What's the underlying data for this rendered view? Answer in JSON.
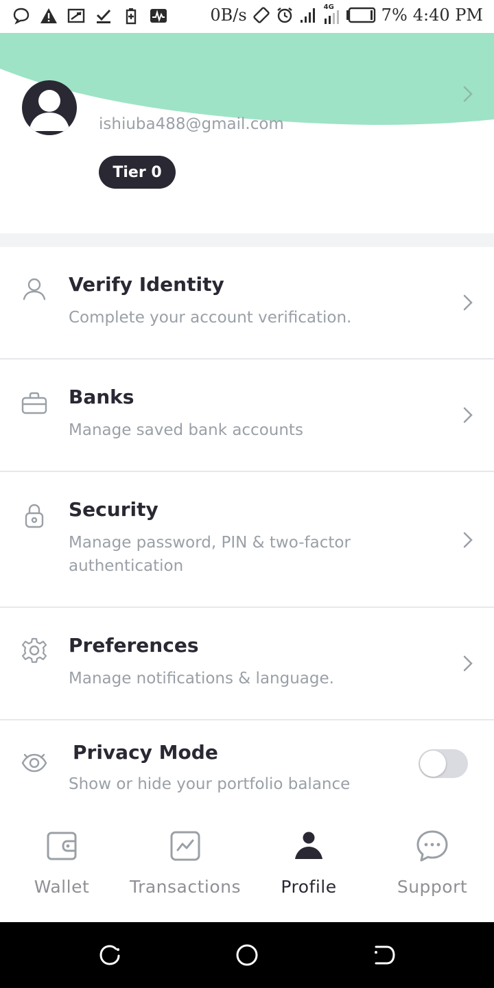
{
  "status_bar": {
    "speed": "0B/s",
    "network_type": "4G",
    "battery": "7%",
    "time": "4:40 PM",
    "left_icons": [
      "chat-bubble-icon",
      "warning-icon",
      "screen-icon",
      "download-done-icon",
      "battery-saver-icon",
      "pulse-icon"
    ]
  },
  "header": {
    "email": "ishiuba488@gmail.com",
    "tier": "Tier 0",
    "accent_color": "#9ee3c6"
  },
  "menu": [
    {
      "icon": "person-icon",
      "title": "Verify Identity",
      "subtitle": "Complete your account verification."
    },
    {
      "icon": "briefcase-icon",
      "title": "Banks",
      "subtitle": "Manage saved bank accounts"
    },
    {
      "icon": "lock-icon",
      "title": "Security",
      "subtitle": "Manage password, PIN & two-factor authentication"
    },
    {
      "icon": "gear-icon",
      "title": "Preferences",
      "subtitle": "Manage notifications & language."
    },
    {
      "icon": "eye-icon",
      "title": "Privacy Mode",
      "subtitle": "Show or hide your portfolio balance",
      "toggle_on": false
    }
  ],
  "bottom_nav": [
    {
      "icon": "wallet-icon",
      "label": "Wallet",
      "active": false
    },
    {
      "icon": "chart-icon",
      "label": "Transactions",
      "active": false
    },
    {
      "icon": "profile-icon",
      "label": "Profile",
      "active": true
    },
    {
      "icon": "chat-icon",
      "label": "Support",
      "active": false
    }
  ]
}
